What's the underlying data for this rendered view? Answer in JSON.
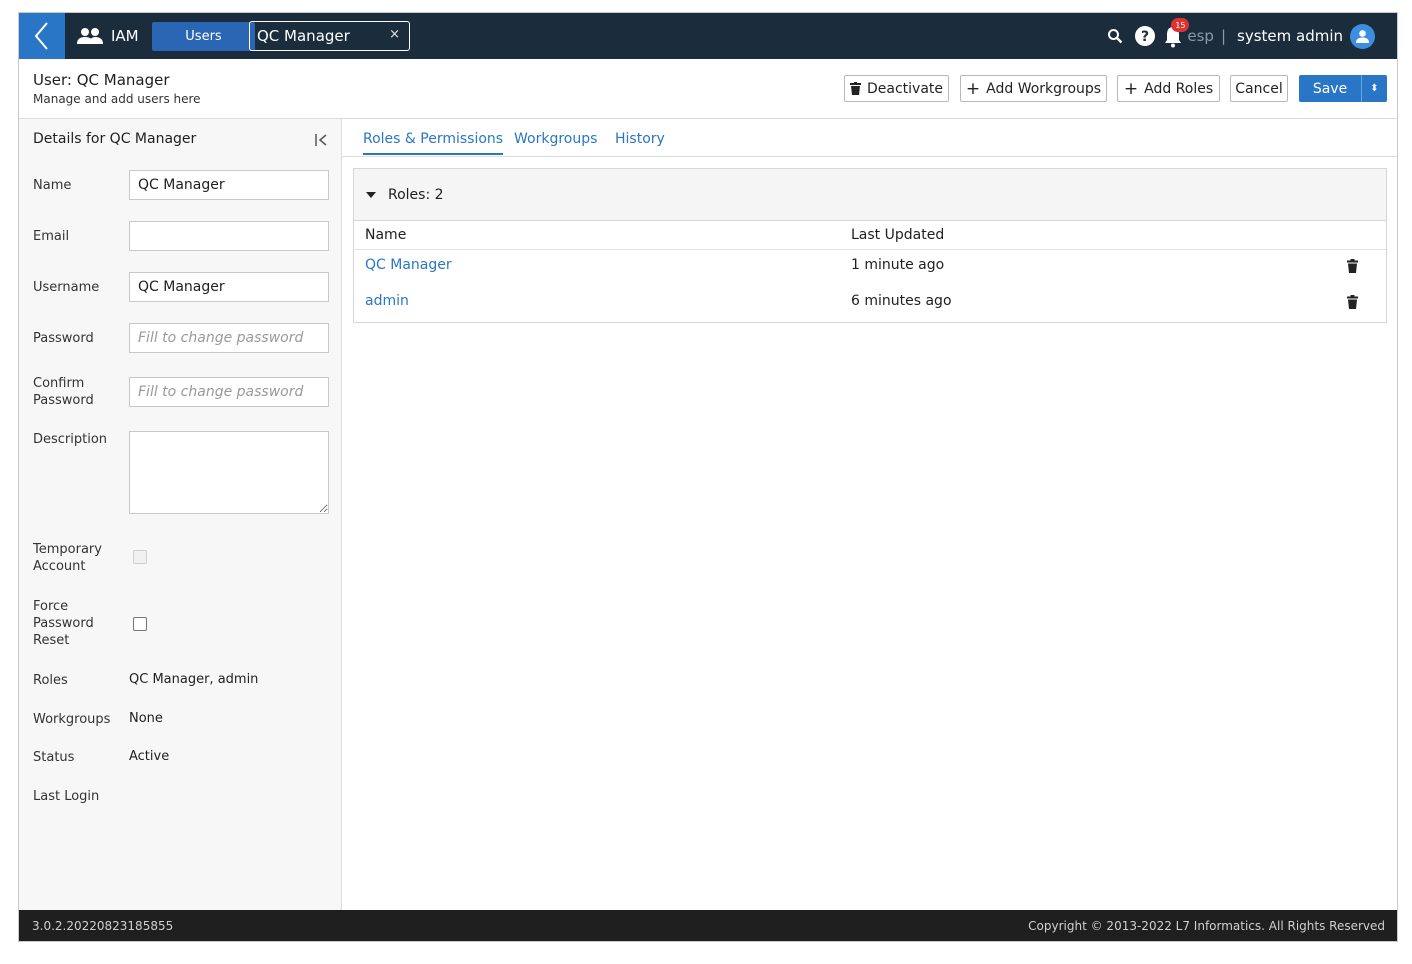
{
  "topbar": {
    "app_name": "IAM",
    "users_tab": "Users",
    "doc_tab": "QC Manager",
    "close_glyph": "×",
    "notification_count": "15",
    "tenant": "esp",
    "separator": "|",
    "user_name": "system admin"
  },
  "header": {
    "title": "User: QC Manager",
    "subtitle": "Manage and add users here",
    "deactivate": "Deactivate",
    "add_workgroups": "Add Workgroups",
    "add_roles": "Add Roles",
    "cancel": "Cancel",
    "save": "Save",
    "save_caret": "⬍"
  },
  "details": {
    "title": "Details for QC Manager",
    "collapse_glyph": "I<",
    "labels": {
      "name": "Name",
      "email": "Email",
      "username": "Username",
      "password": "Password",
      "confirm_password": "Confirm Password",
      "description": "Description",
      "temporary_account": "Temporary Account",
      "force_password_reset": "Force Password Reset",
      "roles": "Roles",
      "workgroups": "Workgroups",
      "status": "Status",
      "last_login": "Last Login"
    },
    "values": {
      "name": "QC Manager",
      "email": "",
      "username": "QC Manager",
      "password_placeholder": "Fill to change password",
      "confirm_placeholder": "Fill to change password",
      "roles": "QC Manager, admin",
      "workgroups": "None",
      "status": "Active"
    }
  },
  "tabs": [
    "Roles & Permissions",
    "Workgroups",
    "History"
  ],
  "roles_table": {
    "header": "Roles: 2",
    "columns": [
      "Name",
      "Last Updated"
    ],
    "rows": [
      {
        "name": "QC Manager",
        "updated": "1 minute ago"
      },
      {
        "name": "admin",
        "updated": "6 minutes ago"
      }
    ]
  },
  "footer": {
    "version": "3.0.2.20220823185855",
    "copyright": "Copyright © 2013-2022 L7 Informatics. All Rights Reserved"
  },
  "colors": {
    "topbar": "#1b2c3d",
    "accent": "#2a76c6",
    "badge": "#e03131",
    "footer": "#1f1f1f"
  }
}
